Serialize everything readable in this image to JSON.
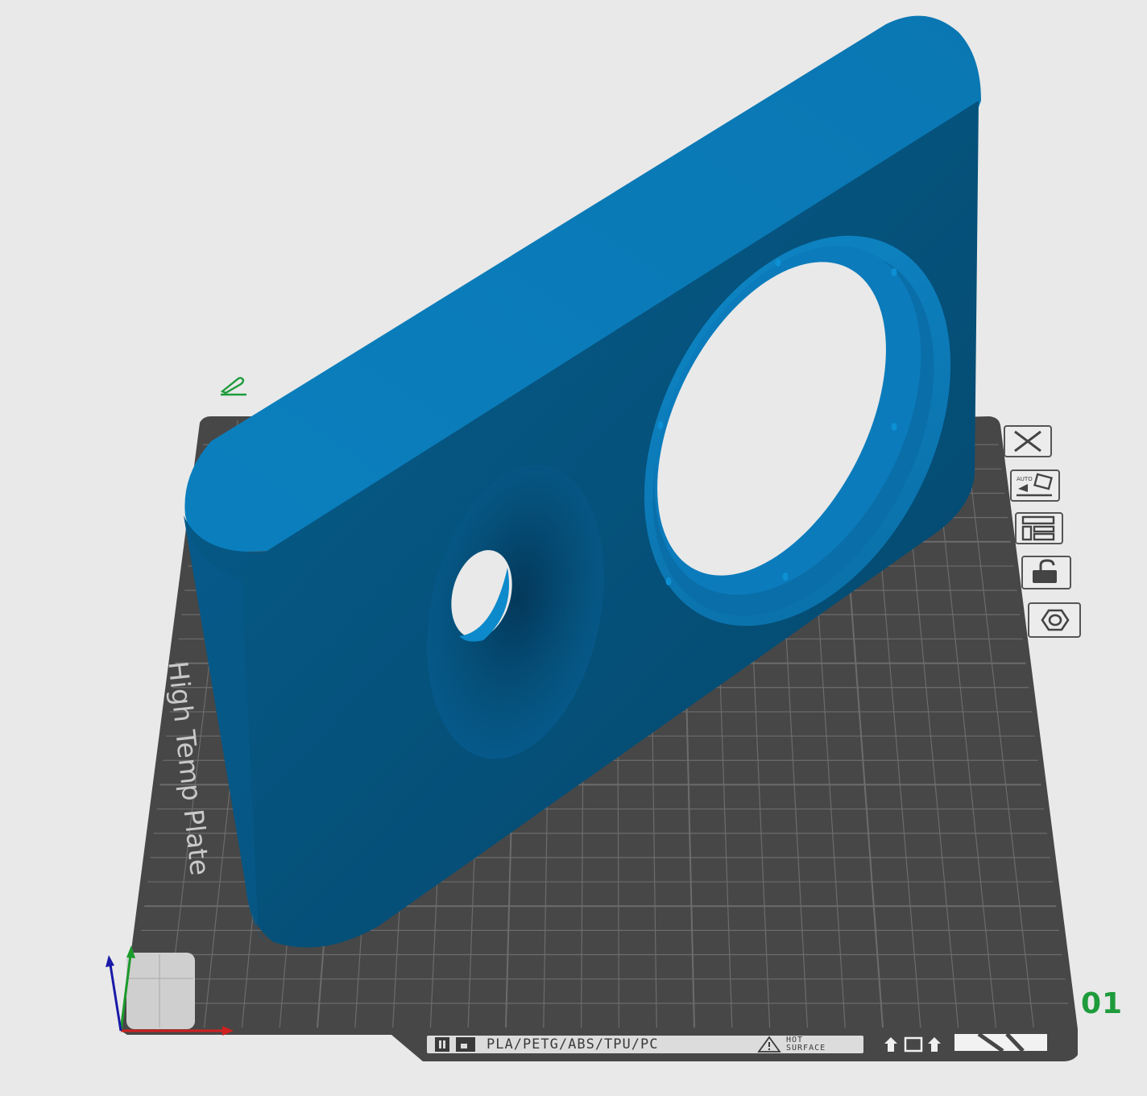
{
  "app": {
    "view": "3D prepare view"
  },
  "plate": {
    "number": "01",
    "bed_label": "High Temp Plate",
    "bed_label_visible": "High Temp Plate",
    "materials": "PLA/PETG/ABS/TPU/PC",
    "hot_surface_line1": "HOT",
    "hot_surface_line2": "SURFACE"
  },
  "toolbar": {
    "items": [
      {
        "name": "remove-plate",
        "icon": "close-icon"
      },
      {
        "name": "auto-orient",
        "icon": "auto-orient-icon",
        "badge": "AUTO"
      },
      {
        "name": "arrange",
        "icon": "arrange-icon"
      },
      {
        "name": "lock",
        "icon": "unlocked-padlock-icon"
      },
      {
        "name": "plate-settings",
        "icon": "hexagon-nut-icon"
      }
    ]
  },
  "colors": {
    "background": "#e9e9e9",
    "bed": "#474747",
    "grid": "#6a6a6a",
    "model": "#0a78b4",
    "model_shadow": "#05466b",
    "plate_number": "#1e9b3b",
    "axis_x": "#d0201f",
    "axis_y": "#1c9a2c",
    "axis_z": "#1a1aa8"
  }
}
